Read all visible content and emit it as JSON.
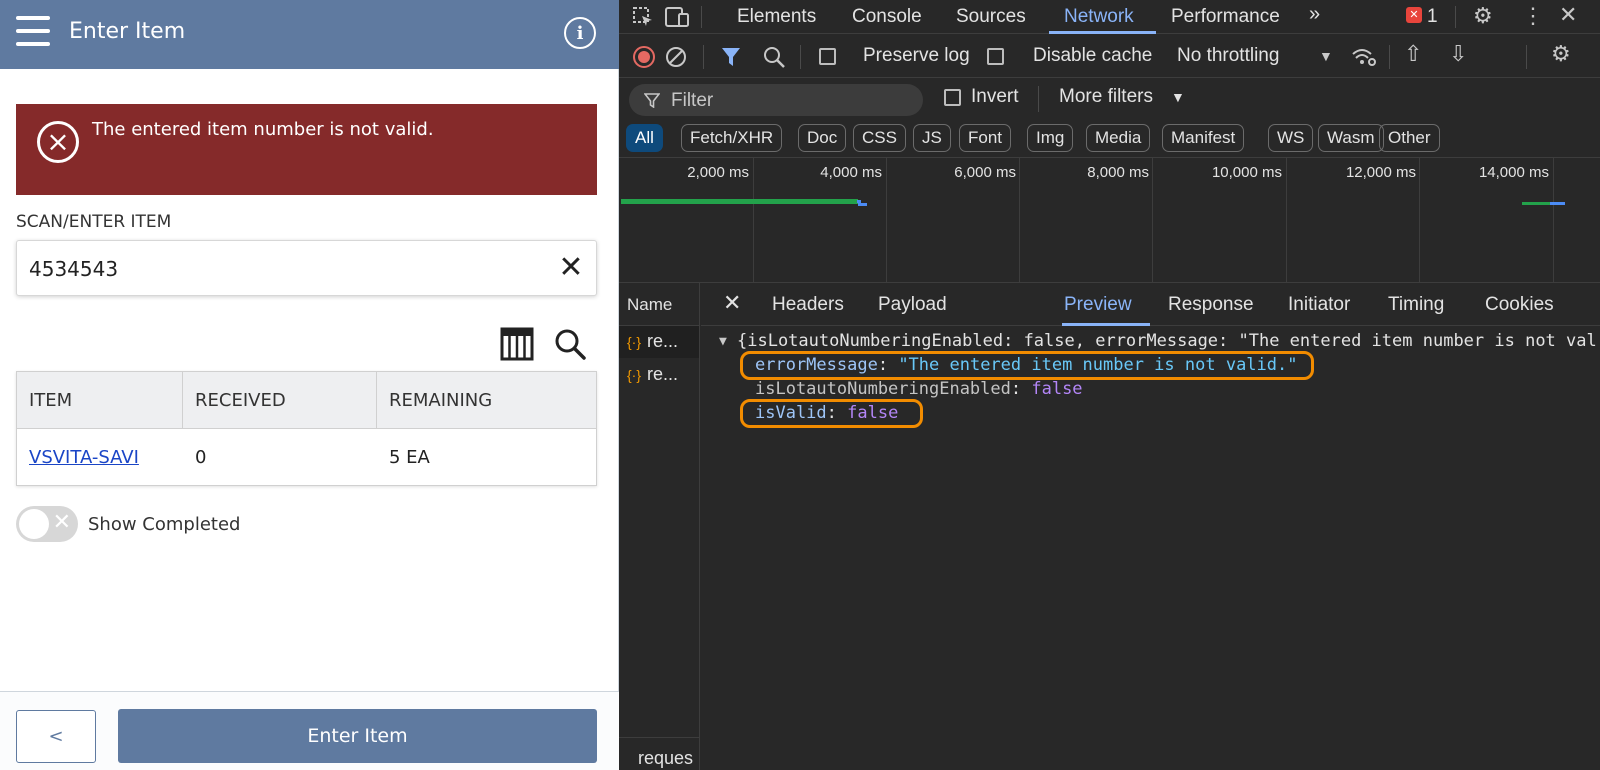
{
  "app": {
    "title": "Enter Item",
    "error_message": "The entered item number is not valid.",
    "scan_label": "SCAN/ENTER ITEM",
    "scan_value": "4534543",
    "table": {
      "headers": [
        "ITEM",
        "RECEIVED",
        "REMAINING"
      ],
      "rows": [
        {
          "item": "VSVITA-SAVI",
          "received": "0",
          "remaining": "5 EA"
        }
      ]
    },
    "show_completed_label": "Show Completed",
    "show_completed_on": false,
    "back_label": "<",
    "enter_label": "Enter Item",
    "colors": {
      "header": "#5f7aa0",
      "error": "#852a2a",
      "link": "#1a45c6"
    }
  },
  "devtools": {
    "tabs": [
      "Elements",
      "Console",
      "Sources",
      "Network",
      "Performance"
    ],
    "active_tab": "Network",
    "error_count": "1",
    "toolbar": {
      "preserve_log": "Preserve log",
      "disable_cache": "Disable cache",
      "throttling": "No throttling"
    },
    "filter_placeholder": "Filter",
    "invert_label": "Invert",
    "more_filters": "More filters",
    "type_filters": [
      "All",
      "Fetch/XHR",
      "Doc",
      "CSS",
      "JS",
      "Font",
      "Img",
      "Media",
      "Manifest",
      "WS",
      "Wasm",
      "Other"
    ],
    "timeline_ticks": [
      "2,000 ms",
      "4,000 ms",
      "6,000 ms",
      "8,000 ms",
      "10,000 ms",
      "12,000 ms",
      "14,000 ms"
    ],
    "name_header": "Name",
    "requests": [
      "re...",
      "re..."
    ],
    "footer_text": "reques",
    "detail_tabs": [
      "Headers",
      "Payload",
      "Preview",
      "Response",
      "Initiator",
      "Timing",
      "Cookies"
    ],
    "active_detail_tab": "Preview",
    "preview": {
      "summary": "{isLotautoNumberingEnabled: false, errorMessage: \"The entered item number is not val",
      "fields": [
        {
          "key": "errorMessage",
          "value": "\"The entered item number is not valid.\"",
          "type": "string",
          "highlighted": true
        },
        {
          "key": "isLotautoNumberingEnabled",
          "value": "false",
          "type": "boolean",
          "highlighted": false
        },
        {
          "key": "isValid",
          "value": "false",
          "type": "boolean",
          "highlighted": true
        }
      ]
    },
    "colors": {
      "accent": "#8ab4f8",
      "highlight": "#f28c00"
    }
  }
}
